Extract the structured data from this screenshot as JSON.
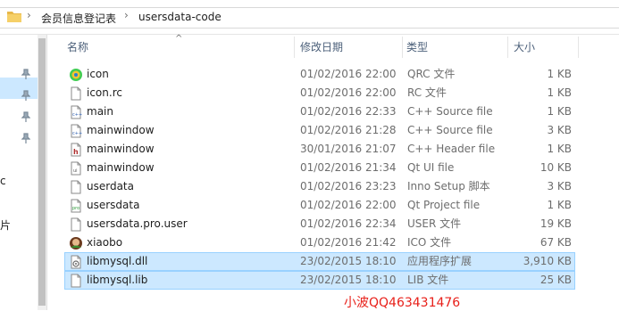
{
  "breadcrumb": {
    "items": [
      "会员信息登记表",
      "usersdata-code"
    ]
  },
  "nav": {
    "partial_labels": [
      "c",
      "片"
    ]
  },
  "columns": {
    "name": "名称",
    "date": "修改日期",
    "type": "类型",
    "size": "大小"
  },
  "files": [
    {
      "name": "icon",
      "date": "01/02/2016 22:00",
      "type": "QRC 文件",
      "size": "1 KB",
      "icon": "qt-resource-icon",
      "selected": false
    },
    {
      "name": "icon.rc",
      "date": "01/02/2016 22:00",
      "type": "RC 文件",
      "size": "1 KB",
      "icon": "generic-file-icon",
      "selected": false
    },
    {
      "name": "main",
      "date": "01/02/2016 22:33",
      "type": "C++ Source file",
      "size": "1 KB",
      "icon": "cpp-source-icon",
      "selected": false
    },
    {
      "name": "mainwindow",
      "date": "01/02/2016 21:28",
      "type": "C++ Source file",
      "size": "3 KB",
      "icon": "cpp-source-icon",
      "selected": false
    },
    {
      "name": "mainwindow",
      "date": "30/01/2016 21:07",
      "type": "C++ Header file",
      "size": "1 KB",
      "icon": "cpp-header-icon",
      "selected": false
    },
    {
      "name": "mainwindow",
      "date": "01/02/2016 21:34",
      "type": "Qt UI file",
      "size": "10 KB",
      "icon": "qt-ui-icon",
      "selected": false
    },
    {
      "name": "userdata",
      "date": "01/02/2016 23:23",
      "type": "Inno Setup 脚本",
      "size": "3 KB",
      "icon": "generic-file-icon",
      "selected": false
    },
    {
      "name": "usersdata",
      "date": "01/02/2016 22:00",
      "type": "Qt Project file",
      "size": "1 KB",
      "icon": "qt-project-icon",
      "selected": false
    },
    {
      "name": "usersdata.pro.user",
      "date": "01/02/2016 22:34",
      "type": "USER 文件",
      "size": "19 KB",
      "icon": "generic-file-icon",
      "selected": false
    },
    {
      "name": "xiaobo",
      "date": "01/02/2016 21:42",
      "type": "ICO 文件",
      "size": "67 KB",
      "icon": "ico-image-icon",
      "selected": false
    },
    {
      "name": "libmysql.dll",
      "date": "23/02/2015 18:10",
      "type": "应用程序扩展",
      "size": "3,910 KB",
      "icon": "dll-file-icon",
      "selected": true
    },
    {
      "name": "libmysql.lib",
      "date": "23/02/2015 18:10",
      "type": "LIB 文件",
      "size": "25 KB",
      "icon": "generic-file-icon",
      "selected": true
    }
  ],
  "watermark": "小波QQ463431476",
  "colors": {
    "selection_bg": "#cce8ff",
    "selection_border": "#99d1ff",
    "header_text": "#4c607a",
    "watermark": "#e8201a"
  }
}
